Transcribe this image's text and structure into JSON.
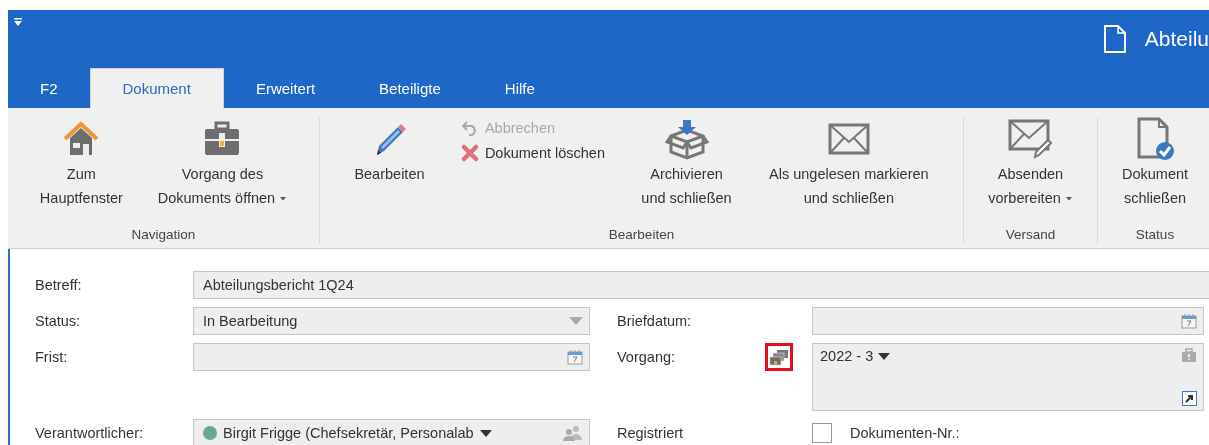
{
  "title_bar": {
    "title": "Abteilu"
  },
  "tabs": [
    {
      "label": "F2",
      "selected": false
    },
    {
      "label": "Dokument",
      "selected": true
    },
    {
      "label": "Erweitert",
      "selected": false
    },
    {
      "label": "Beteiligte",
      "selected": false
    },
    {
      "label": "Hilfe",
      "selected": false
    }
  ],
  "ribbon_groups": [
    {
      "label": "Navigation",
      "items": [
        {
          "kind": "large",
          "lines": [
            "Zum",
            "Hauptfenster"
          ],
          "dropdown": false
        },
        {
          "kind": "large",
          "lines": [
            "Vorgang des",
            "Dokuments öffnen"
          ],
          "dropdown": true
        }
      ]
    },
    {
      "label": "Bearbeiten",
      "items": [
        {
          "kind": "large",
          "lines": [
            "Bearbeiten"
          ],
          "dropdown": false
        },
        {
          "kind": "small_stack",
          "items": [
            {
              "label": "Abbrechen",
              "disabled": true
            },
            {
              "label": "Dokument löschen",
              "disabled": false
            }
          ]
        },
        {
          "kind": "large",
          "lines": [
            "Archivieren",
            "und schließen"
          ],
          "dropdown": false
        },
        {
          "kind": "large",
          "lines": [
            "Als ungelesen markieren",
            "und schließen"
          ],
          "dropdown": false
        }
      ]
    },
    {
      "label": "Versand",
      "items": [
        {
          "kind": "large",
          "lines": [
            "Absenden",
            "vorbereiten"
          ],
          "dropdown": true
        }
      ]
    },
    {
      "label": "Status",
      "items": [
        {
          "kind": "large",
          "lines": [
            "Dokument",
            "schließen"
          ],
          "dropdown": false
        }
      ]
    }
  ],
  "form": {
    "subject": {
      "label": "Betreff:",
      "value": "Abteilungsbericht 1Q24"
    },
    "status": {
      "label": "Status:",
      "value": "In Bearbeitung"
    },
    "deadline": {
      "label": "Frist:"
    },
    "letter_date": {
      "label": "Briefdatum:"
    },
    "case": {
      "label": "Vorgang:",
      "value": "2022 - 3",
      "highlighted": true
    },
    "responsible": {
      "label": "Verantwortlicher:",
      "value": "Birgit Frigge (Chefsekretär, Personalab",
      "color": "#6aa78e"
    },
    "registered": {
      "label": "Registriert",
      "checked": false
    },
    "document_number": {
      "label": "Dokumenten-Nr.:"
    }
  }
}
